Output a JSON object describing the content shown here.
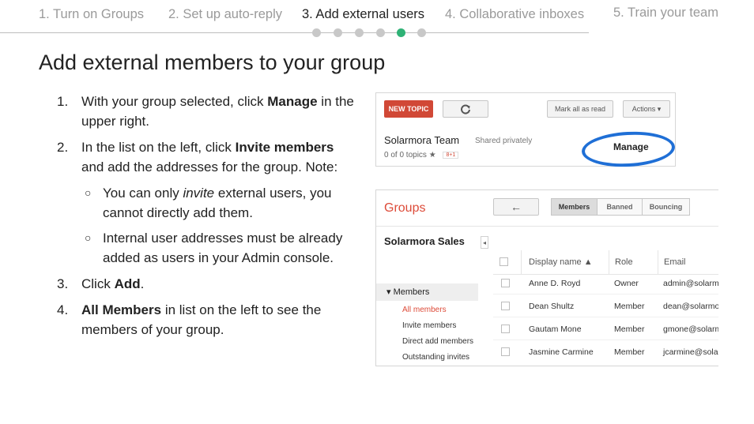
{
  "steps": [
    {
      "label": "1. Turn on Groups",
      "active": false
    },
    {
      "label": "2. Set up auto-reply",
      "active": false
    },
    {
      "label": "3. Add external users",
      "active": true
    },
    {
      "label": "4. Collaborative inboxes",
      "active": false
    },
    {
      "label": "5. Train your team",
      "active": false
    }
  ],
  "progress": {
    "total": 6,
    "current": 5
  },
  "heading": "Add external members to your group",
  "instructions": [
    {
      "num": "1.",
      "pre": "With your group selected, click ",
      "bold": "Manage",
      "post": " in the upper right."
    },
    {
      "num": "2.",
      "pre": "In the list on the left, click ",
      "bold": "Invite members",
      "post": " and add the addresses for the group. Note:",
      "sub": [
        {
          "pre": "You can only ",
          "em": "invite",
          "post": " external users, you cannot directly add them."
        },
        {
          "text": "Internal user addresses must be already added as users in your Admin console."
        }
      ]
    },
    {
      "num": "3.",
      "pre": "Click ",
      "bold": "Add",
      "post": "."
    },
    {
      "num": "4.",
      "pre": "",
      "bold": "All Members",
      "post": " in list on the left to see the members of your group."
    }
  ],
  "shot1": {
    "new_topic": "NEW TOPIC",
    "refresh_icon": "refresh-icon",
    "mark_all_read": "Mark all as read",
    "actions": "Actions ▾",
    "group_name": "Solarmora Team",
    "shared": "Shared privately",
    "topics": "0 of 0 topics ★",
    "gplus": "8+1",
    "manage": "Manage"
  },
  "shot2": {
    "title": "Groups",
    "back_icon": "←",
    "tabs": [
      "Members",
      "Banned",
      "Bouncing"
    ],
    "group_name": "Solarmora Sales",
    "collapse_icon": "◂",
    "members_label": "▾  Members",
    "nav_items": [
      "All members",
      "Invite members",
      "Direct add members",
      "Outstanding invites"
    ],
    "columns": [
      "Display name ▲",
      "Role",
      "Email"
    ],
    "rows": [
      {
        "name": "Anne D. Royd",
        "role": "Owner",
        "email": "admin@solarmora.com"
      },
      {
        "name": "Dean Shultz",
        "role": "Member",
        "email": "dean@solarmora.com"
      },
      {
        "name": "Gautam Mone",
        "role": "Member",
        "email": "gmone@solarmora.com"
      },
      {
        "name": "Jasmine Carmine",
        "role": "Member",
        "email": "jcarmine@solarmora.com"
      }
    ]
  }
}
